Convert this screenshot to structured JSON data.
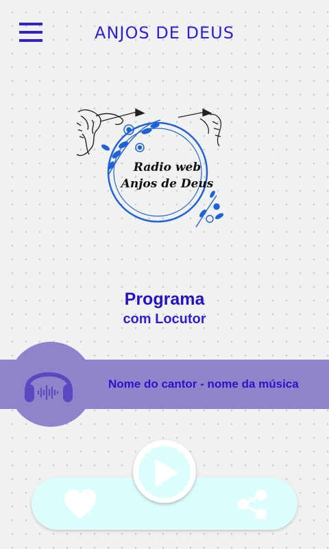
{
  "header": {
    "title": "ANJOS DE DEUS",
    "menu_icon": "hamburger-menu-icon"
  },
  "logo": {
    "line1": "Radio web",
    "line2": "Anjos de Deus",
    "accent_color": "#1f62d8"
  },
  "program": {
    "name": "Programa",
    "host": "com Locutor"
  },
  "now_playing": {
    "song": "Nome do cantor - nome da música",
    "icon": "headphones-icon",
    "band_color": "#8f84cc"
  },
  "controls": {
    "like_icon": "heart-icon",
    "play_icon": "play-icon",
    "share_icon": "share-icon",
    "bar_color": "#dcfdfb"
  },
  "colors": {
    "primary": "#2d1fd6",
    "background": "#f1f1f1"
  }
}
